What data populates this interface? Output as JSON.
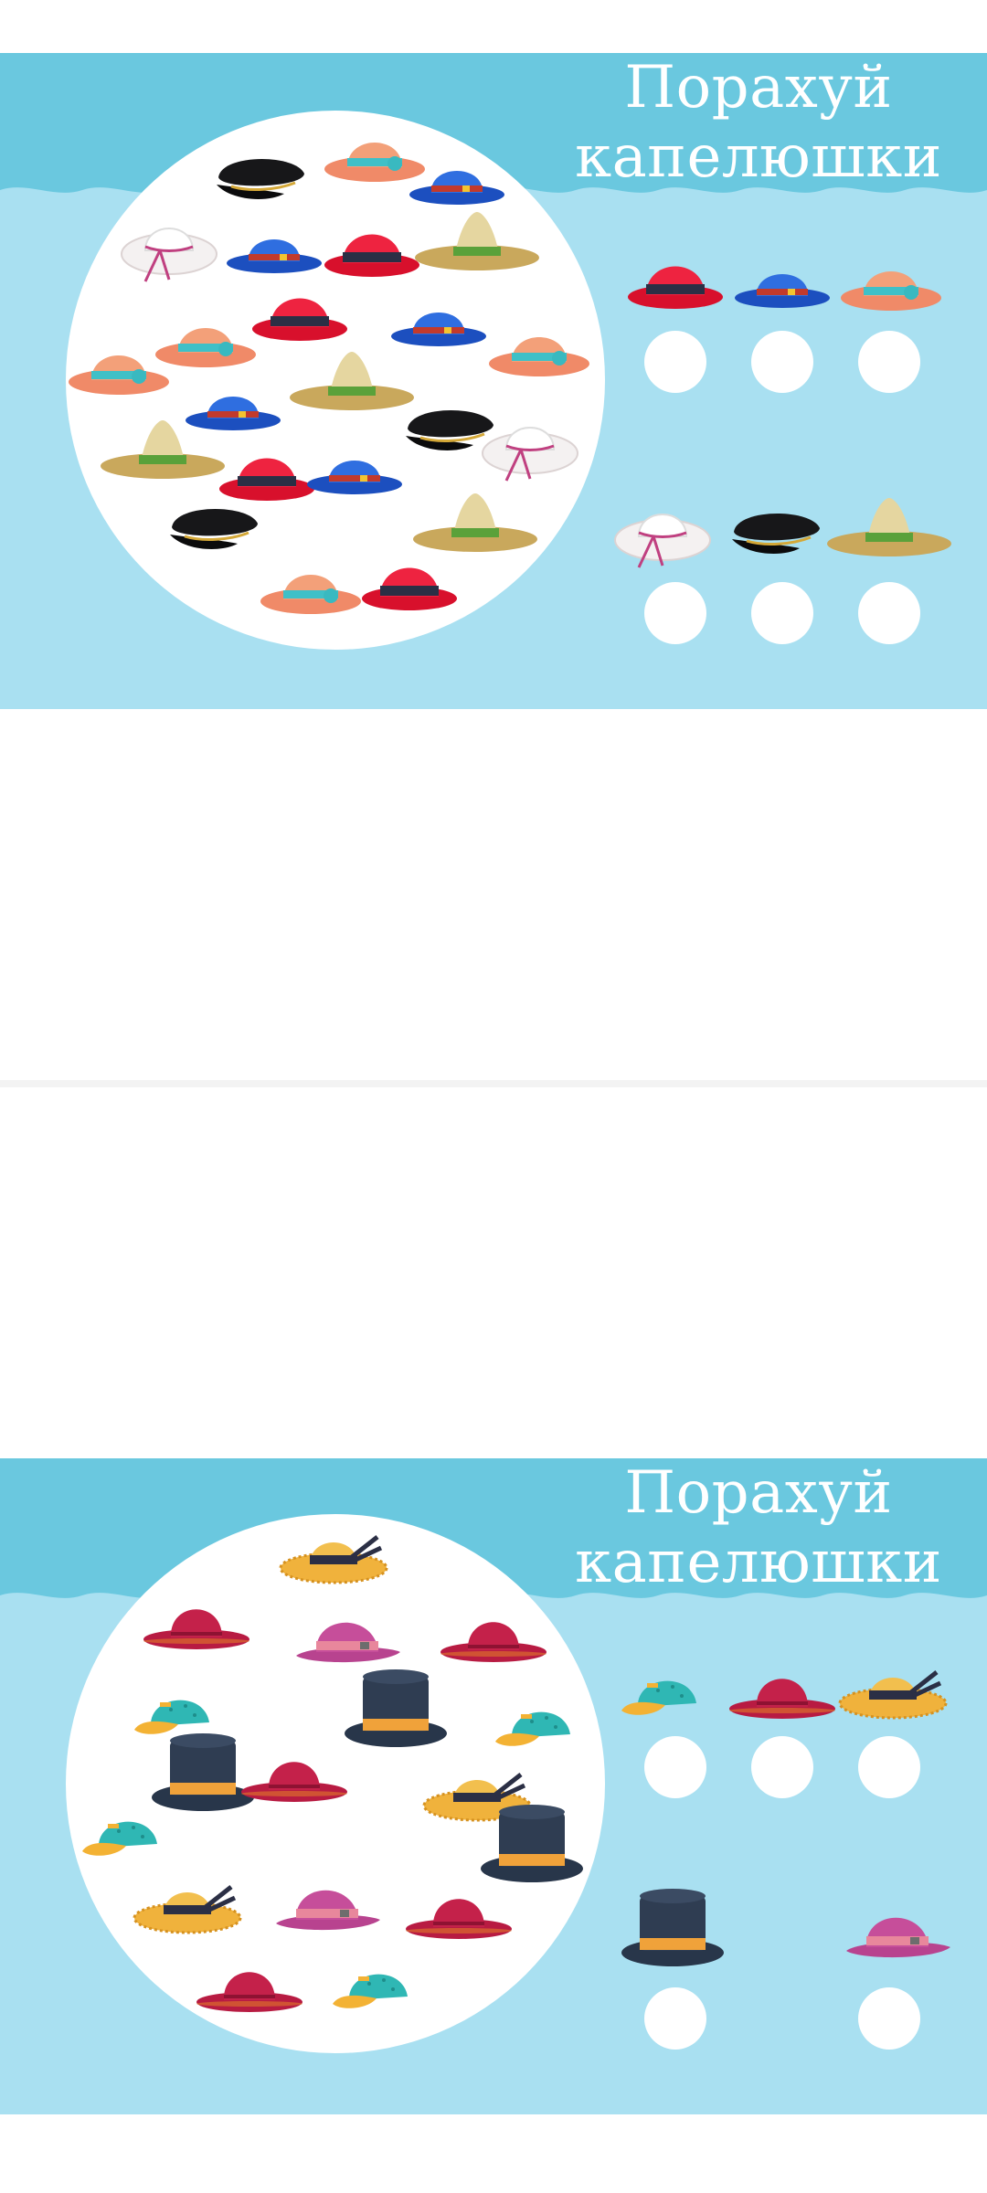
{
  "worksheets": [
    {
      "title_line1": "Порахуй",
      "title_line2": "капелюшки",
      "answer_keys": [
        "red-hat",
        "blue-fedora",
        "peach-hat",
        "white-sun-hat",
        "black-cap",
        "sombrero"
      ]
    },
    {
      "title_line1": "Порахуй",
      "title_line2": "капелюшки",
      "answer_keys": [
        "teal-cap",
        "crimson-hat",
        "straw-hat",
        "top-hat",
        "pink-fedora"
      ]
    }
  ],
  "colors": {
    "sky_light": "#a9e0f1",
    "sky_band": "#6ac8df",
    "circle": "#ffffff"
  }
}
